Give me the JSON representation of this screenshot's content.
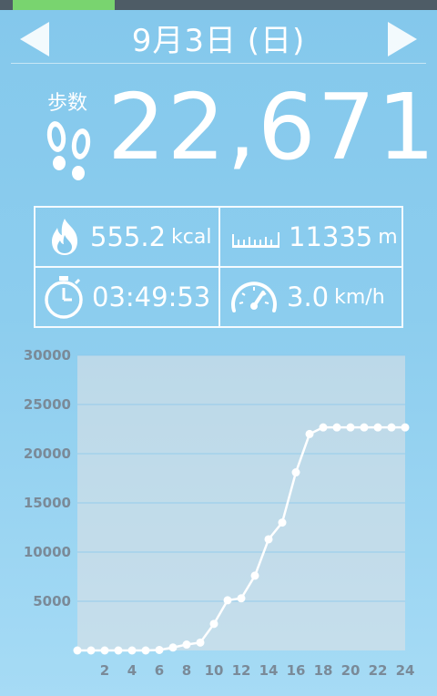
{
  "header": {
    "date": "9月3日 (日)",
    "prev_icon": "triangle-left-icon",
    "next_icon": "triangle-right-icon"
  },
  "steps": {
    "label": "歩数",
    "value": "22,671",
    "icon": "footprints-icon"
  },
  "stats": {
    "calories": {
      "value": "555.2",
      "unit": "kcal",
      "icon": "flame-icon"
    },
    "distance": {
      "value": "11335",
      "unit": "m",
      "icon": "ruler-icon"
    },
    "duration": {
      "value": "03:49:53",
      "icon": "stopwatch-icon"
    },
    "speed": {
      "value": "3.0",
      "unit": "km/h",
      "icon": "speedometer-icon"
    }
  },
  "colors": {
    "topbar": "#4e5c66",
    "progress": "#79d46f",
    "background": "#84c8ec"
  },
  "chart_data": {
    "type": "line",
    "x": [
      0,
      1,
      2,
      3,
      4,
      5,
      6,
      7,
      8,
      9,
      10,
      11,
      12,
      13,
      14,
      15,
      16,
      17,
      18,
      19,
      20,
      21,
      22,
      23,
      24
    ],
    "values": [
      0,
      0,
      0,
      0,
      0,
      0,
      50,
      300,
      600,
      800,
      2700,
      5100,
      5300,
      7600,
      11300,
      13000,
      18100,
      22000,
      22671,
      22671,
      22671,
      22671,
      22671,
      22671,
      22671
    ],
    "xticks": [
      "2",
      "4",
      "6",
      "8",
      "10",
      "12",
      "14",
      "16",
      "18",
      "20",
      "22",
      "24"
    ],
    "yticks": [
      "5000",
      "10000",
      "15000",
      "20000",
      "25000",
      "30000"
    ],
    "xlim": [
      0,
      24
    ],
    "ylim": [
      0,
      30000
    ],
    "grid": true
  }
}
